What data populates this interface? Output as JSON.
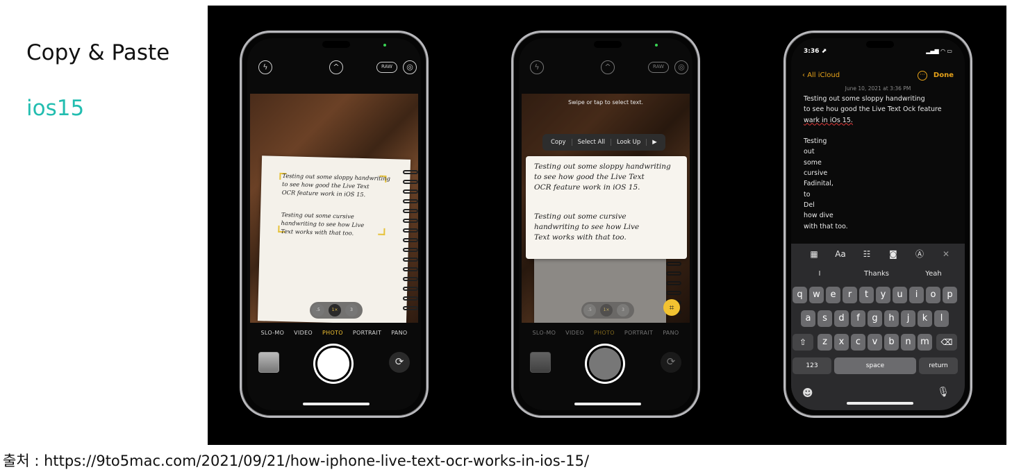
{
  "slide": {
    "title": "Copy & Paste",
    "subtitle": "ios15",
    "source": "출처 : https://9to5mac.com/2021/09/21/how-iphone-live-text-ocr-works-in-ios-15/"
  },
  "camera": {
    "top_icons": [
      "flash-icon",
      "chevron-up-icon",
      "raw-badge",
      "live-photo-icon"
    ],
    "raw_label": "RAW",
    "zoom_levels": [
      ".5",
      "1×",
      "3"
    ],
    "modes": [
      "SLO-MO",
      "VIDEO",
      "PHOTO",
      "PORTRAIT",
      "PANO"
    ],
    "active_mode": "PHOTO"
  },
  "handwriting": {
    "para1": [
      "Testing out some sloppy handwriting",
      "to see how good the Live Text",
      "OCR feature work in iOS 15."
    ],
    "para2": [
      "Testing out some cursive",
      "handwriting to see how Live",
      "Text works with that too."
    ]
  },
  "live_text": {
    "hint": "Swipe or tap to select text.",
    "menu": [
      "Copy",
      "Select All",
      "Look Up",
      "▶"
    ]
  },
  "notes": {
    "time": "3:36 ⬈",
    "back": "All iCloud",
    "done": "Done",
    "date": "June 10, 2021 at 3:36 PM",
    "lines": [
      "Testing out some sloppy handwriting",
      "to see hou good the Live Text Ock feature",
      "wark in iOs 15.",
      "",
      "Testing",
      "out",
      "some",
      "cursive",
      "Fadinital,",
      "to",
      "Del",
      "how dive",
      "with that too."
    ],
    "suggestions": [
      "I",
      "Thanks",
      "Yeah"
    ],
    "keys_row1": [
      "q",
      "w",
      "e",
      "r",
      "t",
      "y",
      "u",
      "i",
      "o",
      "p"
    ],
    "keys_row2": [
      "a",
      "s",
      "d",
      "f",
      "g",
      "h",
      "j",
      "k",
      "l"
    ],
    "keys_row3": [
      "z",
      "x",
      "c",
      "v",
      "b",
      "n",
      "m"
    ],
    "key_123": "123",
    "key_space": "space",
    "key_return": "return"
  }
}
